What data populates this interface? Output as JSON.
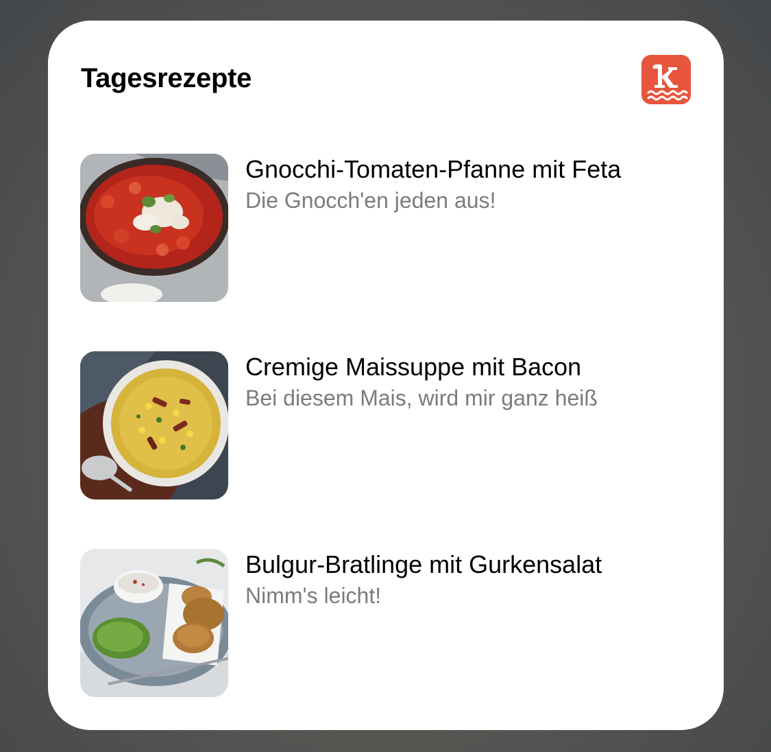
{
  "widget": {
    "title": "Tagesrezepte",
    "app_icon": "kitchen-stories-logo-icon",
    "brand_color": "#e8553e"
  },
  "recipes": [
    {
      "title": "Gnocchi-Tomaten-Pfanne mit Feta",
      "subtitle": "Die Gnocch'en jeden aus!",
      "image": "gnocchi-tomato-pan-image"
    },
    {
      "title": "Cremige Maissuppe mit Bacon",
      "subtitle": "Bei diesem Mais, wird mir ganz heiß",
      "image": "corn-soup-bowl-image"
    },
    {
      "title": "Bulgur-Bratlinge mit Gurkensalat",
      "subtitle": "Nimm's leicht!",
      "image": "bulgur-patties-plate-image"
    }
  ]
}
